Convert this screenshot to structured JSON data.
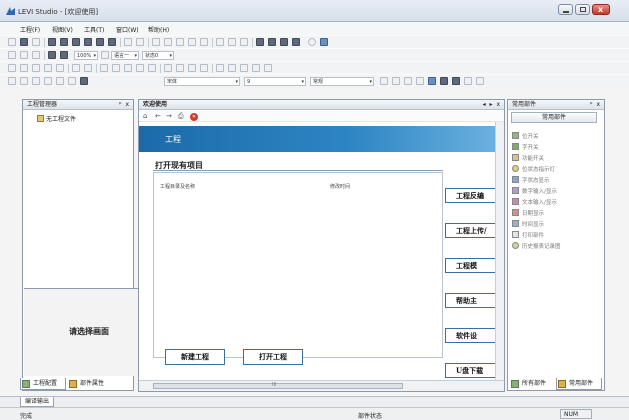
{
  "window": {
    "title": "LEVI Studio - [欢迎使用]"
  },
  "menu": [
    "工程(F)",
    "视图(V)",
    "工具(T)",
    "窗口(W)",
    "帮助(H)"
  ],
  "toolbar": {
    "zoom": "100%",
    "lang": "语言一",
    "state": "状态0",
    "font": "宋体",
    "size": "9",
    "style": "常规"
  },
  "project_panel": {
    "title": "工程管理器",
    "controls": "ᵖ x",
    "tree_item": "无工程文件",
    "select_label": "请选择画面",
    "tabs": [
      "工程配置",
      "部件属性"
    ]
  },
  "doc": {
    "tab": "欢迎使用",
    "controls": "◂ ▸ x",
    "banner_title": "工程",
    "section_title": "打开现有项目",
    "columns": {
      "name": "工程目录及名称",
      "time": "修改时间"
    },
    "side_buttons": [
      "工程反编",
      "工程上传/",
      "工程模",
      "帮助主",
      "软件设",
      "U盘下载"
    ],
    "buttons": {
      "new": "新建工程",
      "open": "打开工程"
    },
    "scroll_label": "III"
  },
  "parts_panel": {
    "title": "常用部件",
    "controls": "ᵖ x",
    "button": "常用部件",
    "items": [
      "位开关",
      "字开关",
      "功能开关",
      "位状态指示灯",
      "字状态显示",
      "数字输入/显示",
      "文本输入/显示",
      "日期显示",
      "时间显示",
      "打印部件",
      "历史报表记录图"
    ],
    "tabs": [
      "所有部件",
      "常用部件"
    ]
  },
  "output": {
    "tab": "编译输出"
  },
  "status": {
    "left": "完成",
    "mid": "部件状态",
    "num": "NUM"
  },
  "colors": {
    "banner": "#2e86c4",
    "button_border": "#3b6e9c",
    "accent": "#1c6aa9"
  }
}
